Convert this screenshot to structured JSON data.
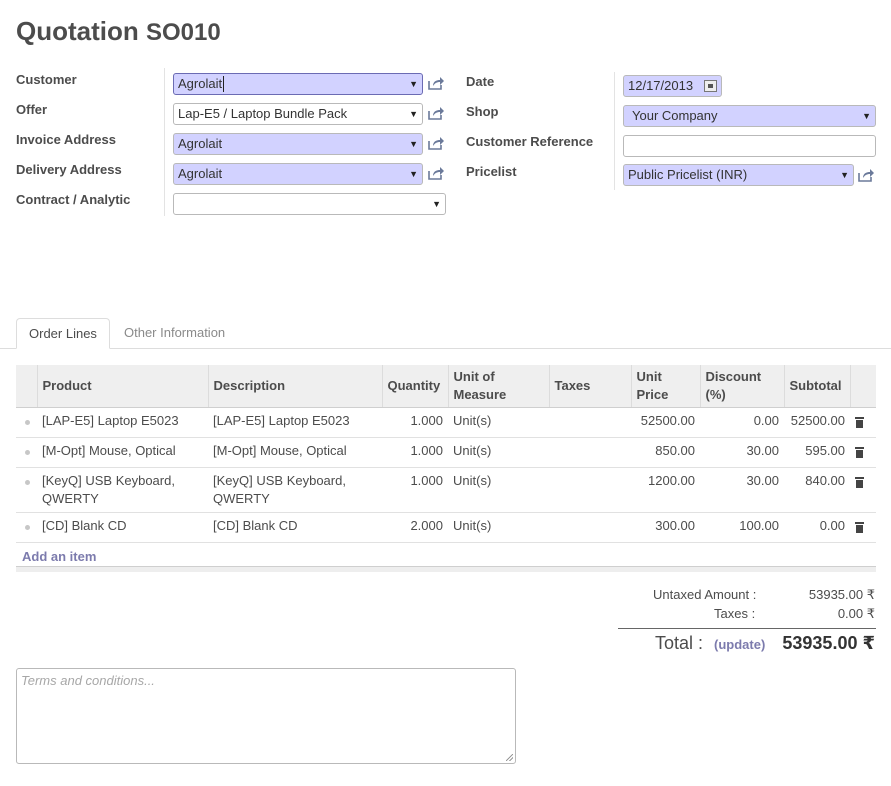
{
  "title": {
    "label": "Quotation",
    "number": "SO010"
  },
  "left_form": {
    "customer_label": "Customer",
    "customer_value": "Agrolait",
    "offer_label": "Offer",
    "offer_value": "Lap-E5 / Laptop Bundle Pack",
    "invoice_label": "Invoice Address",
    "invoice_value": "Agrolait",
    "delivery_label": "Delivery Address",
    "delivery_value": "Agrolait",
    "contract_label": "Contract / Analytic",
    "contract_value": ""
  },
  "right_form": {
    "date_label": "Date",
    "date_value": "12/17/2013",
    "shop_label": "Shop",
    "shop_value": "Your Company",
    "custref_label": "Customer Reference",
    "custref_value": "",
    "pricelist_label": "Pricelist",
    "pricelist_value": "Public Pricelist (INR)"
  },
  "tabs": [
    {
      "label": "Order Lines",
      "active": true
    },
    {
      "label": "Other Information",
      "active": false
    }
  ],
  "table": {
    "headers": {
      "product": "Product",
      "description": "Description",
      "quantity": "Quantity",
      "uom_1": "Unit of",
      "uom_2": "Measure",
      "taxes": "Taxes",
      "unit_price_1": "Unit",
      "unit_price_2": "Price",
      "discount_1": "Discount",
      "discount_2": "(%)",
      "subtotal": "Subtotal"
    },
    "rows": [
      {
        "product": "[LAP-E5] Laptop E5023",
        "description": "[LAP-E5] Laptop E5023",
        "quantity": "1.000",
        "uom": "Unit(s)",
        "taxes": "",
        "unit_price": "52500.00",
        "discount": "0.00",
        "subtotal": "52500.00"
      },
      {
        "product": "[M-Opt] Mouse, Optical",
        "description": "[M-Opt] Mouse, Optical",
        "quantity": "1.000",
        "uom": "Unit(s)",
        "taxes": "",
        "unit_price": "850.00",
        "discount": "30.00",
        "subtotal": "595.00"
      },
      {
        "product_1": "[KeyQ] USB Keyboard,",
        "product_2": "QWERTY",
        "description_1": "[KeyQ] USB Keyboard,",
        "description_2": "QWERTY",
        "quantity": "1.000",
        "uom": "Unit(s)",
        "taxes": "",
        "unit_price": "1200.00",
        "discount": "30.00",
        "subtotal": "840.00"
      },
      {
        "product": "[CD] Blank CD",
        "description": "[CD] Blank CD",
        "quantity": "2.000",
        "uom": "Unit(s)",
        "taxes": "",
        "unit_price": "300.00",
        "discount": "100.00",
        "subtotal": "0.00"
      }
    ],
    "add_item": "Add an item"
  },
  "totals": {
    "untaxed_label": "Untaxed Amount :",
    "untaxed_value": "53935.00 ₹",
    "taxes_label": "Taxes :",
    "taxes_value": "0.00 ₹",
    "total_label": "Total :",
    "update_label": "(update)",
    "total_value": "53935.00 ₹"
  },
  "terms": {
    "placeholder": "Terms and conditions..."
  },
  "icons": {
    "external": "external-link-icon",
    "dropdown": "dropdown-arrow-icon",
    "calendar": "calendar-icon",
    "delete": "trash-icon"
  },
  "colors": {
    "required_bg": "#d2d2ff",
    "link": "#7c7bad"
  }
}
